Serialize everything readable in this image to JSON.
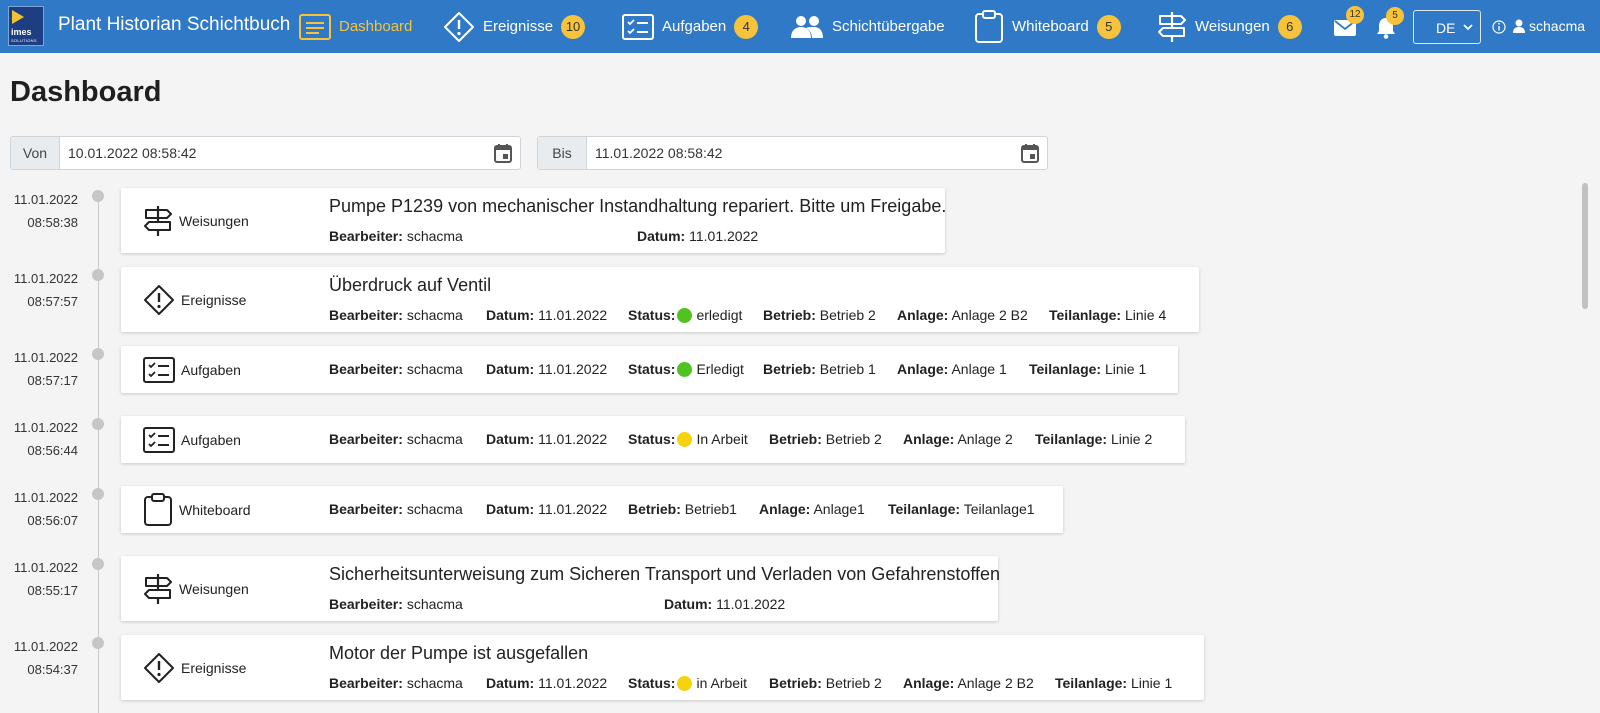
{
  "app": {
    "logo_text": "imes",
    "logo_sub": "SOLUTIONS",
    "title": "Plant Historian Schichtbuch"
  },
  "nav": [
    {
      "label": "Dashboard",
      "icon": "list-icon",
      "active": true
    },
    {
      "label": "Ereignisse",
      "icon": "warning-diamond-icon",
      "badge": "10"
    },
    {
      "label": "Aufgaben",
      "icon": "checklist-icon",
      "badge": "4"
    },
    {
      "label": "Schichtübergabe",
      "icon": "users-icon"
    },
    {
      "label": "Whiteboard",
      "icon": "clipboard-icon",
      "badge": "5"
    },
    {
      "label": "Weisungen",
      "icon": "signpost-icon",
      "badge": "6"
    }
  ],
  "header_icons": {
    "mail_badge": "12",
    "bell_badge": "5"
  },
  "language": {
    "selected": "DE"
  },
  "user": {
    "name": "schacma"
  },
  "page": {
    "title": "Dashboard"
  },
  "filter": {
    "from_label": "Von",
    "from_value": "10.01.2022 08:58:42",
    "to_label": "Bis",
    "to_value": "11.01.2022 08:58:42"
  },
  "labels": {
    "bearbeiter": "Bearbeiter:",
    "datum": "Datum:",
    "status": "Status:",
    "betrieb": "Betrieb:",
    "anlage": "Anlage:",
    "teilanlage": "Teilanlage:"
  },
  "status_colors": {
    "green": "#4fc31f",
    "yellow": "#f5d30f"
  },
  "entries": [
    {
      "date": "11.01.2022",
      "time": "08:58:38",
      "category": "Weisungen",
      "icon": "signpost-icon",
      "title": "Pumpe P1239 von mechanischer Instandhaltung repariert. Bitte um Freigabe.",
      "bearbeiter": "schacma",
      "datum": "11.01.2022"
    },
    {
      "date": "11.01.2022",
      "time": "08:57:57",
      "category": "Ereignisse",
      "icon": "warning-diamond-icon",
      "title": "Überdruck auf Ventil",
      "bearbeiter": "schacma",
      "datum": "11.01.2022",
      "status": "erledigt",
      "status_color": "green",
      "betrieb": "Betrieb 2",
      "anlage": "Anlage 2 B2",
      "teilanlage": "Linie 4"
    },
    {
      "date": "11.01.2022",
      "time": "08:57:17",
      "category": "Aufgaben",
      "icon": "checklist-icon",
      "bearbeiter": "schacma",
      "datum": "11.01.2022",
      "status": "Erledigt",
      "status_color": "green",
      "betrieb": "Betrieb 1",
      "anlage": "Anlage 1",
      "teilanlage": "Linie 1"
    },
    {
      "date": "11.01.2022",
      "time": "08:56:44",
      "category": "Aufgaben",
      "icon": "checklist-icon",
      "bearbeiter": "schacma",
      "datum": "11.01.2022",
      "status": "In Arbeit",
      "status_color": "yellow",
      "betrieb": "Betrieb 2",
      "anlage": "Anlage 2",
      "teilanlage": "Linie 2"
    },
    {
      "date": "11.01.2022",
      "time": "08:56:07",
      "category": "Whiteboard",
      "icon": "clipboard-icon",
      "bearbeiter": "schacma",
      "datum": "11.01.2022",
      "betrieb": "Betrieb1",
      "anlage": "Anlage1",
      "teilanlage": "Teilanlage1"
    },
    {
      "date": "11.01.2022",
      "time": "08:55:17",
      "category": "Weisungen",
      "icon": "signpost-icon",
      "title": "Sicherheitsunterweisung zum Sicheren Transport und Verladen von Gefahrenstoffen",
      "bearbeiter": "schacma",
      "datum": "11.01.2022"
    },
    {
      "date": "11.01.2022",
      "time": "08:54:37",
      "category": "Ereignisse",
      "icon": "warning-diamond-icon",
      "title": "Motor der Pumpe ist ausgefallen",
      "bearbeiter": "schacma",
      "datum": "11.01.2022",
      "status": "in Arbeit",
      "status_color": "yellow",
      "betrieb": "Betrieb 2",
      "anlage": "Anlage 2 B2",
      "teilanlage": "Linie 1"
    }
  ]
}
